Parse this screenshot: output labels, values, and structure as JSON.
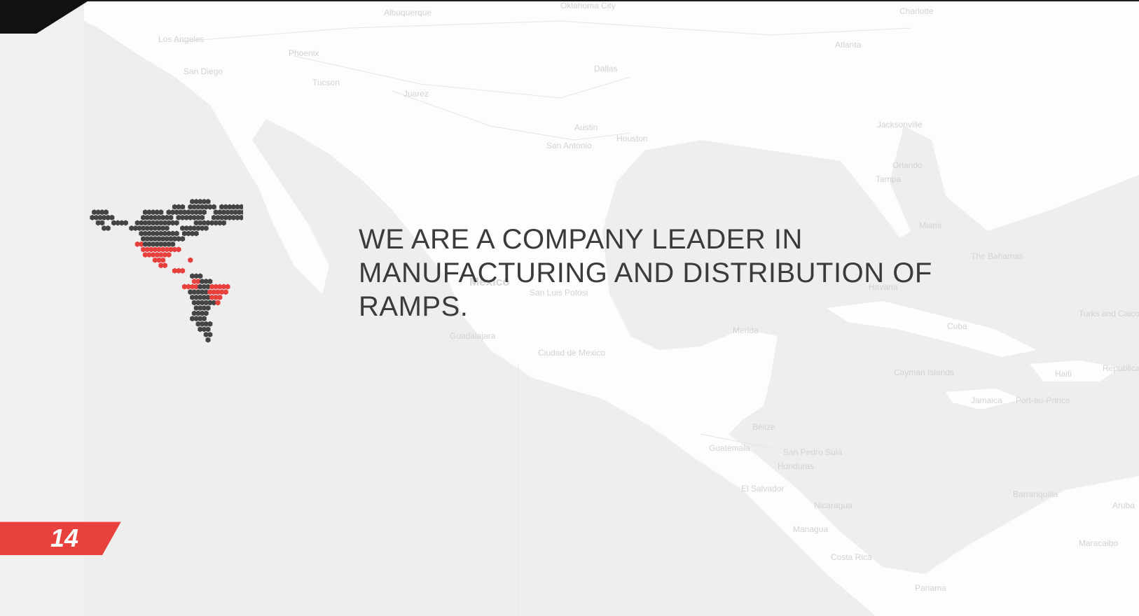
{
  "headline": "WE ARE A COMPANY LEADER IN MANUFACTURING AND DISTRIBUTION OF RAMPS.",
  "page_number": "14",
  "map_labels": [
    "Albuquerque",
    "Oklahoma City",
    "Charlotte",
    "Los Angeles",
    "Phoenix",
    "Atlanta",
    "San Diego",
    "Dallas",
    "Tucson",
    "Juarez",
    "Austin",
    "Houston",
    "San Antonio",
    "Jacksonville",
    "Orlando",
    "Tampa",
    "Miami",
    "Mexico",
    "San Luis Potosi",
    "Guadalajara",
    "Ciudad de Mexico",
    "Cuba",
    "Merida",
    "Belize",
    "Guatemala",
    "San Pedro Sula",
    "Honduras",
    "El Salvador",
    "Nicaragua",
    "Managua",
    "Costa Rica",
    "Panama",
    "Cayman Islands",
    "Haiti",
    "Jamaica",
    "Port-au-Prince",
    "Turks and Caicos Islands",
    "Barranquilla",
    "Maracaibo",
    "Aruba",
    "The Bahamas",
    "Havana",
    "Republica Dominicana"
  ],
  "colors": {
    "accent_red": "#e8403c",
    "hex_dark": "#444444",
    "text_dark": "#3b3b3b"
  }
}
